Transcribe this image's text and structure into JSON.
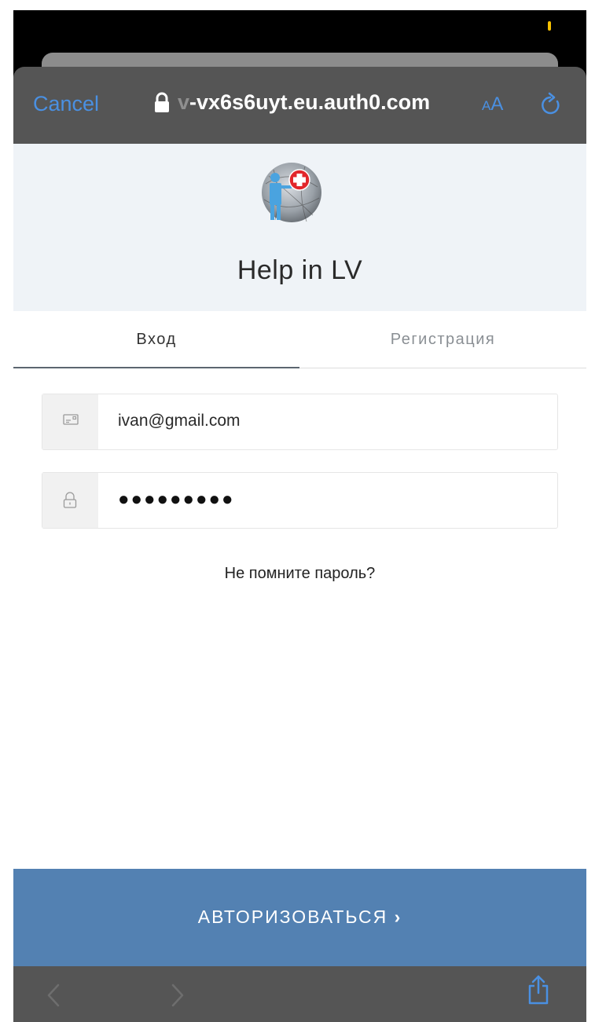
{
  "browser": {
    "cancel_label": "Cancel",
    "url_prefix": "v",
    "url": "-vx6s6uyt.eu.auth0.com",
    "text_size_small": "A",
    "text_size_large": "A"
  },
  "app": {
    "title": "Help in LV"
  },
  "tabs": [
    {
      "label": "Вход",
      "active": true
    },
    {
      "label": "Регистрация",
      "active": false
    }
  ],
  "form": {
    "email_value": "ivan@gmail.com",
    "password_masked": "●●●●●●●●●",
    "forgot_password": "Не помните пароль?"
  },
  "submit": {
    "label": "АВТОРИЗОВАТЬСЯ",
    "chevron": "›"
  },
  "icons": {
    "lock": "lock-icon",
    "reload": "reload-icon",
    "email": "envelope-icon",
    "password": "padlock-icon",
    "back": "back-chevron-icon",
    "forward": "forward-chevron-icon",
    "share": "share-icon"
  },
  "colors": {
    "accent": "#4a90e2",
    "submit": "#5381b2",
    "browser_chrome": "#555555",
    "header_panel": "#eff3f7"
  }
}
